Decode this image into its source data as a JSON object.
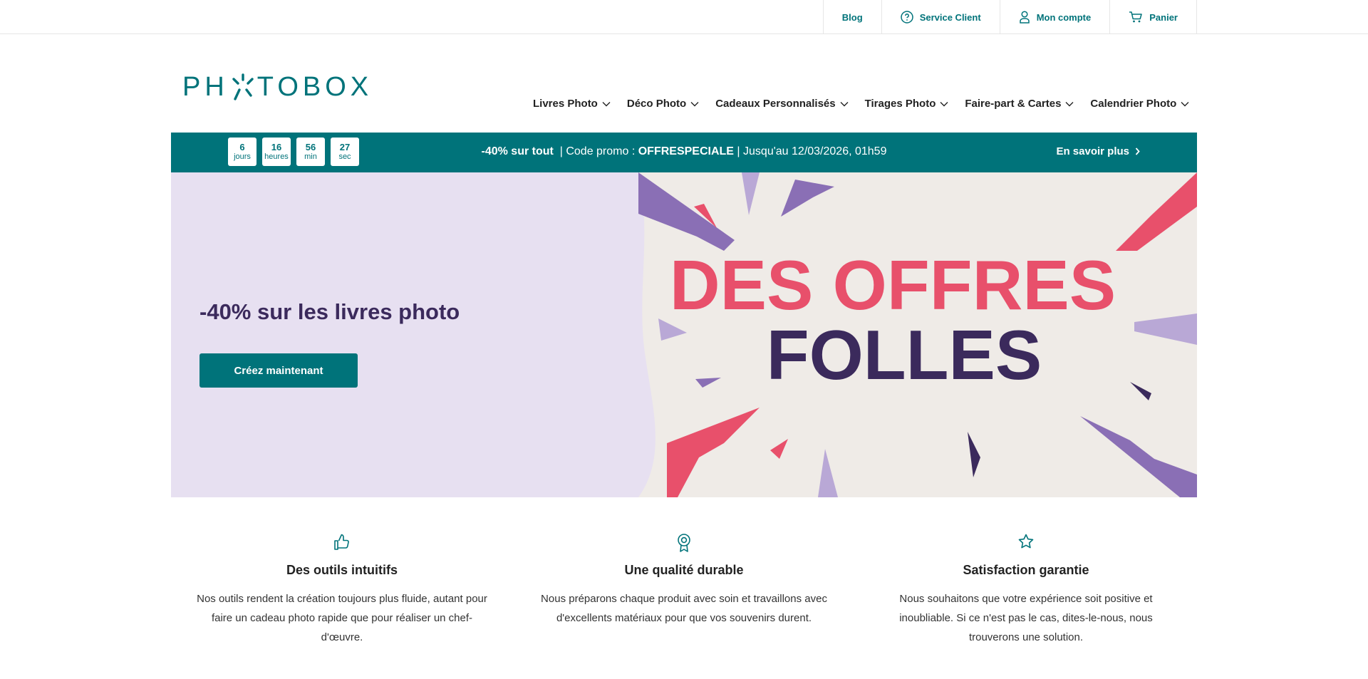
{
  "util_nav": {
    "blog": "Blog",
    "service": "Service Client",
    "account": "Mon compte",
    "cart": "Panier"
  },
  "logo": {
    "text": "PHOTOBOX",
    "left": "PH",
    "right": "TOBOX"
  },
  "main_nav": [
    "Livres Photo",
    "Déco Photo",
    "Cadeaux Personnalisés",
    "Tirages Photo",
    "Faire-part & Cartes",
    "Calendrier Photo"
  ],
  "promo": {
    "countdown": [
      {
        "value": "6",
        "unit": "jours"
      },
      {
        "value": "16",
        "unit": "heures"
      },
      {
        "value": "56",
        "unit": "min"
      },
      {
        "value": "27",
        "unit": "sec"
      }
    ],
    "headline": "-40% sur tout",
    "code_label": "| Code promo :",
    "code": "OFFRESPECIALE",
    "deadline": "| Jusqu'au 12/03/2026, 01h59",
    "link": "En savoir plus"
  },
  "hero": {
    "title": "-40% sur les livres photo",
    "cta": "Créez maintenant",
    "art_line1": "DES OFFRES",
    "art_line2": "FOLLES"
  },
  "features": [
    {
      "icon": "thumbs-up-icon",
      "title": "Des outils intuitifs",
      "text": "Nos outils rendent la création toujours plus fluide, autant pour faire un cadeau photo rapide que pour réaliser un chef-d'œuvre."
    },
    {
      "icon": "award-badge-icon",
      "title": "Une qualité durable",
      "text": "Nous préparons chaque produit avec soin et travaillons avec d'excellents matériaux pour que vos souvenirs durent."
    },
    {
      "icon": "star-icon",
      "title": "Satisfaction garantie",
      "text": "Nous souhaitons que votre expérience soit positive et inoubliable. Si ce n'est pas le cas, dites-le-nous, nous trouverons une solution."
    }
  ],
  "colors": {
    "brand_teal": "#00737a",
    "hero_lavender": "#e7e0f1",
    "art_pink": "#e8506b",
    "art_purple": "#3b2a5c",
    "art_violet": "#8a6fb5"
  }
}
